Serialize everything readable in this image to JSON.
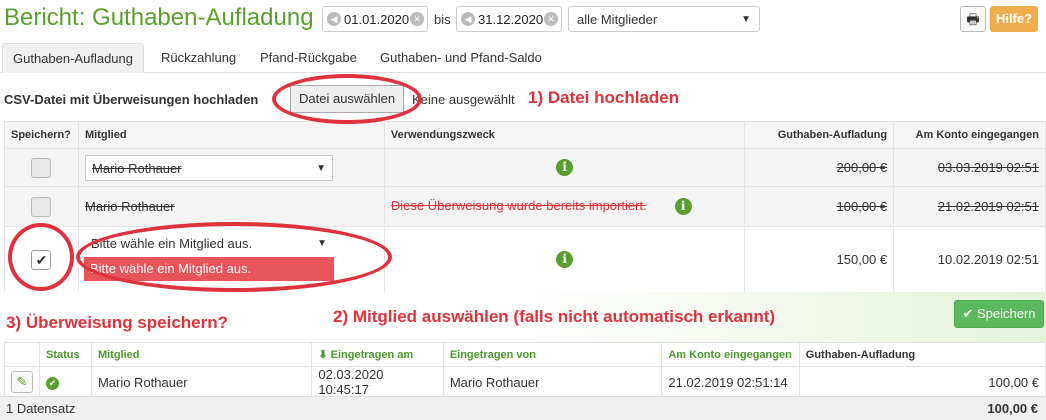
{
  "header": {
    "title": "Bericht: Guthaben-Aufladung",
    "date_from": "01.01.2020",
    "bis": "bis",
    "date_to": "31.12.2020",
    "member_filter": "alle Mitglieder",
    "help": "Hilfe?"
  },
  "tabs": [
    "Guthaben-Aufladung",
    "Rückzahlung",
    "Pfand-Rückgabe",
    "Guthaben- und Pfand-Saldo"
  ],
  "upload": {
    "label": "CSV-Datei mit Überweisungen hochladen",
    "file_button": "Datei auswählen",
    "file_status": "Keine ausgewählt"
  },
  "annotations": {
    "a1": "1) Datei hochladen",
    "a2": "2) Mitglied auswählen (falls nicht automatisch erkannt)",
    "a3": "3) Überweisung speichern?"
  },
  "grid": {
    "headers": [
      "Speichern?",
      "Mitglied",
      "Verwendungszweck",
      "Guthaben-Aufladung",
      "Am Konto eingegangen"
    ],
    "rows": [
      {
        "member": "Mario Rothauer",
        "note": "",
        "amount": "200,00 €",
        "date": "03.03.2019 02:51"
      },
      {
        "member": "Mario Rothauer",
        "note": "Diese Überweisung wurde bereits importiert.",
        "amount": "100,00 €",
        "date": "21.02.2019 02:51"
      },
      {
        "member": "Bitte wähle ein Mitglied aus.",
        "note": "",
        "amount": "150,00 €",
        "date": "10.02.2019 02:51"
      }
    ],
    "dropdown_option": "Bitte wähle ein Mitglied aus."
  },
  "save_label": "Speichern",
  "lower": {
    "headers": [
      "Status",
      "Mitglied",
      "Eingetragen am",
      "Eingetragen von",
      "Am Konto eingegangen",
      "Guthaben-Aufladung"
    ],
    "row": {
      "member": "Mario Rothauer",
      "entered_at": "02.03.2020 10:45:17",
      "entered_by": "Mario Rothauer",
      "received": "21.02.2019 02:51:14",
      "amount": "100,00 €"
    },
    "footer_count": "1 Datensatz",
    "footer_total": "100,00 €"
  },
  "colors": {
    "accent": "#5aa02c",
    "annotation": "#e0323c",
    "help": "#f0ad4e",
    "dropdown": "#e85459"
  }
}
